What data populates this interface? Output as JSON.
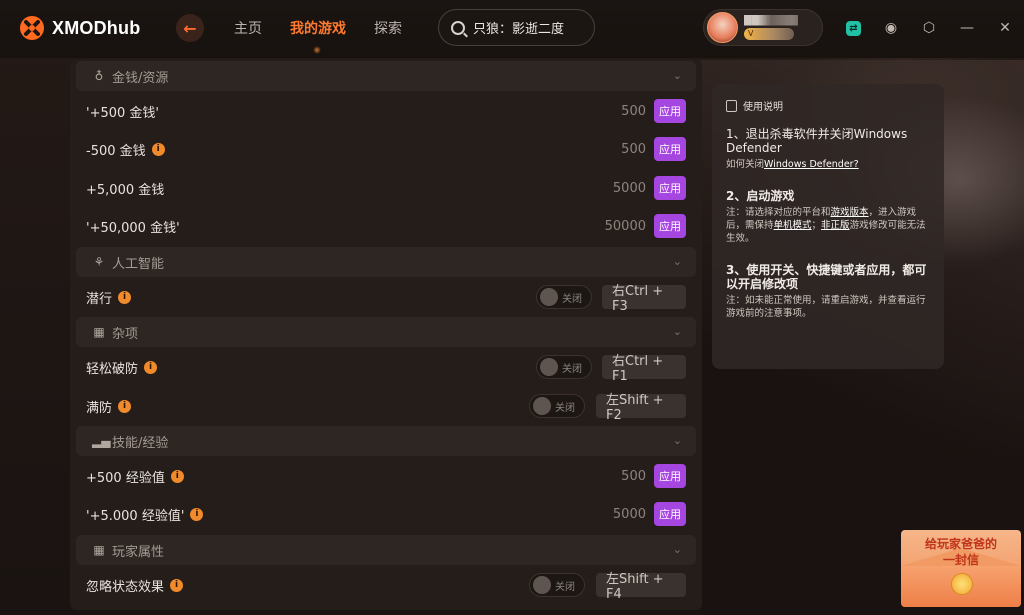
{
  "app": {
    "brand": "XMODhub"
  },
  "nav": {
    "items": [
      "主页",
      "我的游戏",
      "探索"
    ],
    "active_index": 1
  },
  "search": {
    "value": "只狼：影逝二度"
  },
  "user": {
    "badge": "V"
  },
  "sections": {
    "money": {
      "title": "金钱/资源",
      "rows": [
        {
          "label": "'+500 金钱'",
          "value": "500",
          "action": "应用",
          "info": false
        },
        {
          "label": "-500 金钱",
          "value": "500",
          "action": "应用",
          "info": true
        },
        {
          "label": "+5,000 金钱",
          "value": "5000",
          "action": "应用",
          "info": false
        },
        {
          "label": "'+50,000 金钱'",
          "value": "50000",
          "action": "应用",
          "info": false
        }
      ]
    },
    "ai": {
      "title": "人工智能",
      "rows": [
        {
          "label": "潜行",
          "toggle": "关闭",
          "hotkey": "右Ctrl + F3",
          "info": true
        }
      ]
    },
    "misc": {
      "title": "杂项",
      "rows": [
        {
          "label": "轻松破防",
          "toggle": "关闭",
          "hotkey": "右Ctrl + F1",
          "info": true
        },
        {
          "label": "满防",
          "toggle": "关闭",
          "hotkey": "左Shift + F2",
          "info": true
        }
      ]
    },
    "skills": {
      "title": "技能/经验",
      "rows": [
        {
          "label": "+500 经验值",
          "value": "500",
          "action": "应用",
          "info": true
        },
        {
          "label": "'+5.000 经验值'",
          "value": "5000",
          "action": "应用",
          "info": true
        }
      ]
    },
    "player": {
      "title": "玩家属性",
      "rows": [
        {
          "label": "忽略状态效果",
          "toggle": "关闭",
          "hotkey": "左Shift + F4",
          "info": true
        }
      ]
    }
  },
  "guide": {
    "title": "使用说明",
    "step1_head": "1、退出杀毒软件并关闭Windows Defender",
    "step1_sub_prefix": "如何关闭",
    "step1_sub_link": "Windows Defender?",
    "step2_head": "2、启动游戏",
    "step2_sub_a": "注：请选择对应的平台和",
    "step2_sub_link1": "游戏版本",
    "step2_sub_b": "，进入游戏后，需保持",
    "step2_sub_link2": "单机模式",
    "step2_sub_c": "；",
    "step2_sub_link3": "非正版",
    "step2_sub_d": "游戏修改可能无法生效。",
    "step3_head": "3、使用开关、快捷键或者应用，都可以开启修改项",
    "step3_sub": "注：如未能正常使用，请重启游戏，并查看运行游戏前的注意事项。"
  },
  "promo": {
    "line1": "给玩家爸爸的",
    "line2": "一封信"
  },
  "colors": {
    "accent": "#ff7a2e",
    "apply": "#a646e0",
    "info": "#f08a2a"
  }
}
